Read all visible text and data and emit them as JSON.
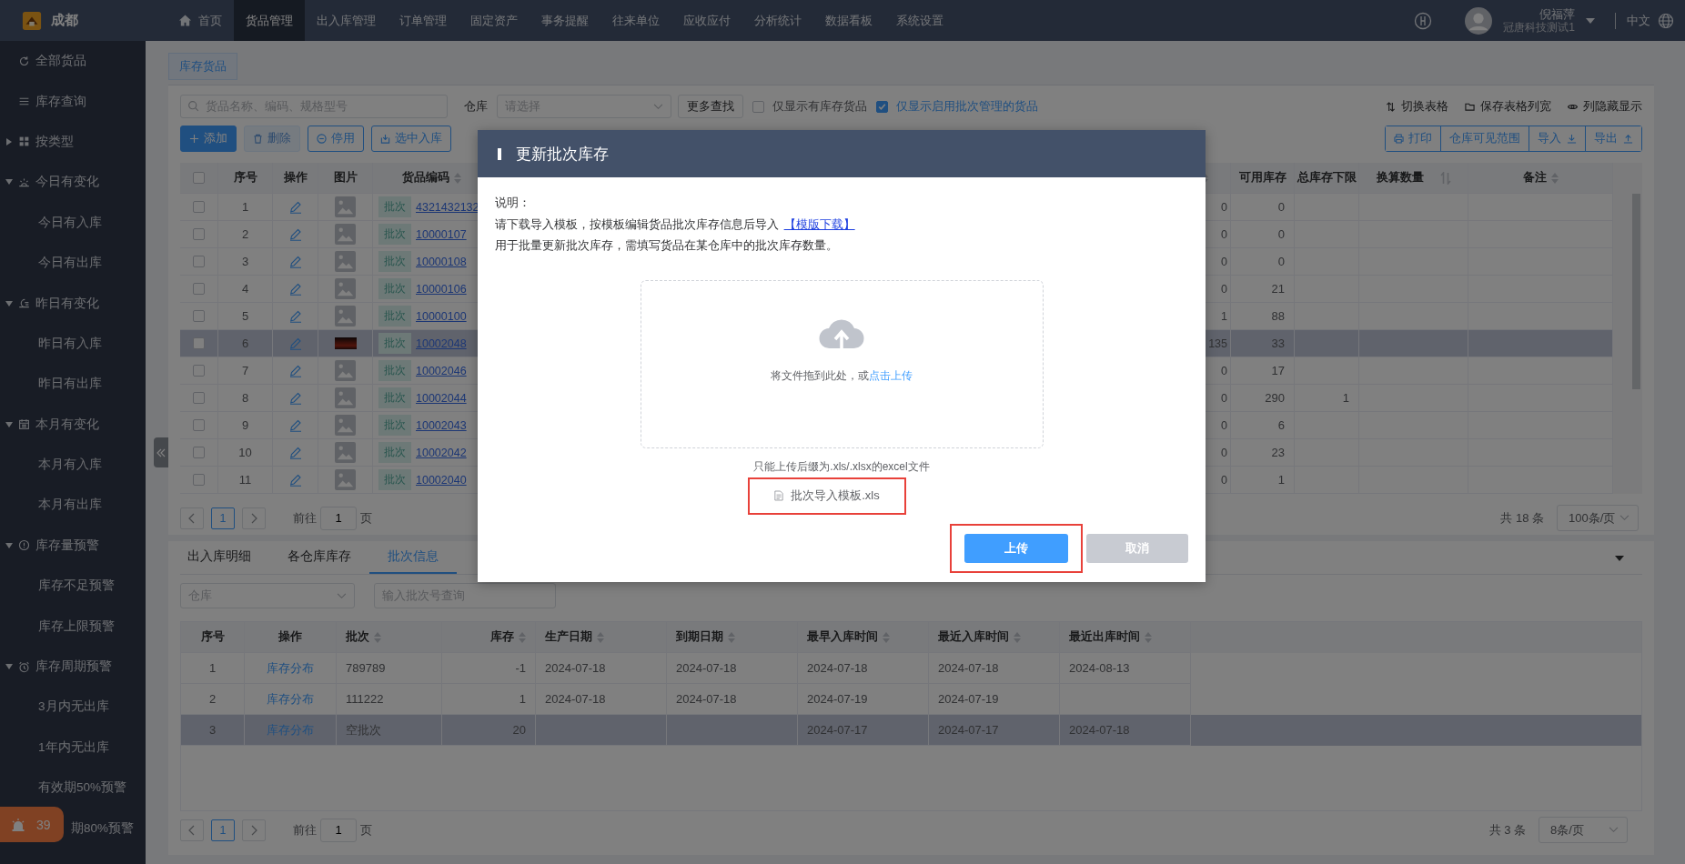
{
  "top_bar": {
    "logo_text": "成都",
    "nav": [
      {
        "label": "首页",
        "selected": false
      },
      {
        "label": "货品管理",
        "selected": true
      },
      {
        "label": "出入库管理",
        "selected": false
      },
      {
        "label": "订单管理",
        "selected": false
      },
      {
        "label": "固定资产",
        "selected": false
      },
      {
        "label": "事务提醒",
        "selected": false
      },
      {
        "label": "往来单位",
        "selected": false
      },
      {
        "label": "应收应付",
        "selected": false
      },
      {
        "label": "分析统计",
        "selected": false
      },
      {
        "label": "数据看板",
        "selected": false
      },
      {
        "label": "系统设置",
        "selected": false
      }
    ],
    "user_name": "倪福萍",
    "company": "冠唐科技测试1",
    "language": "中文"
  },
  "sidebar": {
    "items": [
      {
        "label": "全部货品"
      },
      {
        "label": "库存查询"
      },
      {
        "label": "按类型",
        "expanded": false
      },
      {
        "label": "今日有变化",
        "expanded": true,
        "children": [
          {
            "label": "今日有入库"
          },
          {
            "label": "今日有出库"
          }
        ]
      },
      {
        "label": "昨日有变化",
        "expanded": true,
        "children": [
          {
            "label": "昨日有入库"
          },
          {
            "label": "昨日有出库"
          }
        ]
      },
      {
        "label": "本月有变化",
        "expanded": true,
        "children": [
          {
            "label": "本月有入库"
          },
          {
            "label": "本月有出库"
          }
        ]
      },
      {
        "label": "库存量预警",
        "expanded": true,
        "children": [
          {
            "label": "库存不足预警"
          },
          {
            "label": "库存上限预警"
          }
        ]
      },
      {
        "label": "库存周期预警",
        "expanded": true,
        "children": [
          {
            "label": "3月内无出库"
          },
          {
            "label": "1年内无出库"
          },
          {
            "label": "有效期50%预警"
          },
          {
            "label": "期80%预警"
          }
        ]
      }
    ]
  },
  "alarm_badge": {
    "count": "39"
  },
  "page_tabs": [
    {
      "label": "库存货品",
      "selected": true
    }
  ],
  "toolbar": {
    "search_placeholder": "货品名称、编码、规格型号",
    "warehouse_label": "仓库",
    "warehouse_placeholder": "请选择",
    "more_button": "更多查找",
    "checkboxes": [
      {
        "label": "仅显示有库存货品",
        "checked": false
      },
      {
        "label": "仅显示启用批次管理的货品",
        "checked": true
      }
    ],
    "links": [
      "切换表格",
      "保存表格列宽",
      "列隐藏显示"
    ],
    "actions": [
      {
        "label": "添加",
        "kind": "primary"
      },
      {
        "label": "删除",
        "kind": "disabled"
      },
      {
        "label": "停用",
        "kind": "default"
      },
      {
        "label": "选中入库",
        "kind": "default"
      }
    ],
    "right_actions": [
      "打印",
      "仓库可见范围",
      "导入",
      "导出"
    ]
  },
  "table": {
    "all_checked": false,
    "columns": [
      {
        "label": "序号",
        "kind": "plain"
      },
      {
        "label": "操作",
        "kind": "plain"
      },
      {
        "label": "图片",
        "kind": "plain"
      },
      {
        "label": "货品编码",
        "kind": "sortable"
      },
      {
        "kind": "sortable"
      },
      {
        "label": "可用库存",
        "kind": "plain"
      },
      {
        "label": "总库存下限",
        "kind": "plain"
      },
      {
        "label": "换算数量",
        "kind": "swap"
      },
      {
        "label": "备注",
        "kind": "sortable"
      }
    ],
    "rows": [
      {
        "no": "1",
        "tag": "批次",
        "code": "4321432132",
        "kind": "placeholder",
        "column_6": "0",
        "available": "0",
        "checked": false,
        "selected": false
      },
      {
        "no": "2",
        "tag": "批次",
        "code": "10000107",
        "kind": "placeholder",
        "column_6": "0",
        "available": "0",
        "checked": false,
        "selected": false
      },
      {
        "no": "3",
        "tag": "批次",
        "code": "10000108",
        "kind": "placeholder",
        "column_6": "0",
        "available": "0",
        "checked": false,
        "selected": false
      },
      {
        "no": "4",
        "tag": "批次",
        "code": "10000106",
        "kind": "placeholder",
        "column_6": "0",
        "available": "21",
        "checked": false,
        "selected": false
      },
      {
        "no": "5",
        "tag": "批次",
        "code": "10000100",
        "kind": "placeholder",
        "column_6": "1",
        "available": "88",
        "checked": false,
        "selected": false
      },
      {
        "no": "6",
        "tag": "批次",
        "code": "10002048",
        "kind": "photo",
        "column_6": "135",
        "available": "33",
        "checked": false,
        "selected": true
      },
      {
        "no": "7",
        "tag": "批次",
        "code": "10002046",
        "kind": "placeholder",
        "column_6": "0",
        "available": "17",
        "checked": false,
        "selected": false
      },
      {
        "no": "8",
        "tag": "批次",
        "code": "10002044",
        "kind": "placeholder",
        "column_6": "0",
        "available": "290",
        "min_total": "1",
        "checked": false,
        "selected": false
      },
      {
        "no": "9",
        "tag": "批次",
        "code": "10002043",
        "kind": "placeholder",
        "column_6": "0",
        "available": "6",
        "checked": false,
        "selected": false
      },
      {
        "no": "10",
        "tag": "批次",
        "code": "10002042",
        "kind": "placeholder",
        "column_6": "0",
        "available": "23",
        "checked": false,
        "selected": false
      },
      {
        "no": "11",
        "tag": "批次",
        "code": "10002040",
        "kind": "placeholder",
        "column_6": "0",
        "available": "1",
        "checked": false,
        "selected": false
      }
    ]
  },
  "pagination": {
    "page": "1",
    "goto_label": "前往",
    "goto_value": "1",
    "page_unit": "页",
    "total": "共 18 条",
    "page_size": "100条/页"
  },
  "detail": {
    "tabs": [
      {
        "label": "出入库明细",
        "selected": false
      },
      {
        "label": "各仓库库存",
        "selected": false
      },
      {
        "label": "批次信息",
        "selected": true
      }
    ],
    "warehouse_placeholder": "仓库",
    "batch_placeholder": "输入批次号查询",
    "columns": [
      {
        "label": "序号",
        "kind": "plain"
      },
      {
        "label": "操作",
        "kind": "plain"
      },
      {
        "label": "批次",
        "kind": "sortable"
      },
      {
        "label": "库存",
        "kind": "sortable"
      },
      {
        "label": "生产日期",
        "kind": "sortable"
      },
      {
        "label": "到期日期",
        "kind": "sortable"
      },
      {
        "label": "最早入库时间",
        "kind": "sortable"
      },
      {
        "label": "最近入库时间",
        "kind": "sortable"
      },
      {
        "label": "最近出库时间",
        "kind": "sortable"
      }
    ],
    "rows": [
      {
        "no": "1",
        "action": "库存分布",
        "batch": "789789",
        "stock": "-1",
        "produced": "2024-07-18",
        "expires": "2024-07-18",
        "first_in": "2024-07-18",
        "last_in": "2024-07-18",
        "last_out": "2024-08-13",
        "selected": false
      },
      {
        "no": "2",
        "action": "库存分布",
        "batch": "111222",
        "stock": "1",
        "produced": "2024-07-18",
        "expires": "2024-07-18",
        "first_in": "2024-07-19",
        "last_in": "2024-07-19",
        "selected": false
      },
      {
        "no": "3",
        "action": "库存分布",
        "batch": "空批次",
        "stock": "20",
        "first_in": "2024-07-17",
        "last_in": "2024-07-17",
        "last_out": "2024-07-18",
        "selected": true
      }
    ],
    "pagination": {
      "page": "1",
      "goto_label": "前往",
      "goto_value": "1",
      "page_unit": "页",
      "total": "共 3 条",
      "page_size": "8条/页"
    }
  },
  "modal": {
    "title": "更新批次库存",
    "note_label": "说明：",
    "instruction": "请下载导入模板，按模板编辑货品批次库存信息后导入",
    "download_link": "【模版下载】",
    "usage": "用于批量更新批次库存，需填写货品在某仓库中的批次库存数量。",
    "drop_text": "将文件拖到此处，或",
    "drop_link": "点击上传",
    "tip": "只能上传后缀为.xls/.xlsx的excel文件",
    "file": {
      "name": "批次导入模板.xls",
      "highlighted": true
    },
    "buttons": [
      {
        "label": "上传",
        "kind": "primary",
        "highlighted": true
      },
      {
        "label": "取消",
        "kind": "secondary",
        "highlighted": false
      }
    ]
  }
}
